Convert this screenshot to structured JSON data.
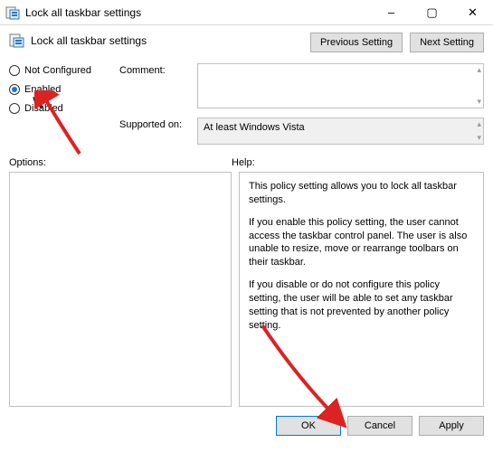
{
  "window": {
    "title": "Lock all taskbar settings",
    "minimize": "–",
    "maximize": "▢",
    "close": "✕"
  },
  "header": {
    "title": "Lock all taskbar settings",
    "prev_btn": "Previous Setting",
    "next_btn": "Next Setting"
  },
  "radios": {
    "not_configured": "Not Configured",
    "enabled": "Enabled",
    "disabled": "Disabled",
    "selected": "enabled"
  },
  "fields": {
    "comment_label": "Comment:",
    "comment_value": "",
    "supported_label": "Supported on:",
    "supported_value": "At least Windows Vista"
  },
  "panels": {
    "options_label": "Options:",
    "help_label": "Help:"
  },
  "help": {
    "p1": "This policy setting allows you to lock all taskbar settings.",
    "p2": "If you enable this policy setting, the user cannot access the taskbar control panel. The user is also unable to resize, move or rearrange toolbars on their taskbar.",
    "p3": "If you disable or do not configure this policy setting, the user will be able to set any taskbar setting that is not prevented by another policy setting."
  },
  "footer": {
    "ok": "OK",
    "cancel": "Cancel",
    "apply": "Apply"
  }
}
